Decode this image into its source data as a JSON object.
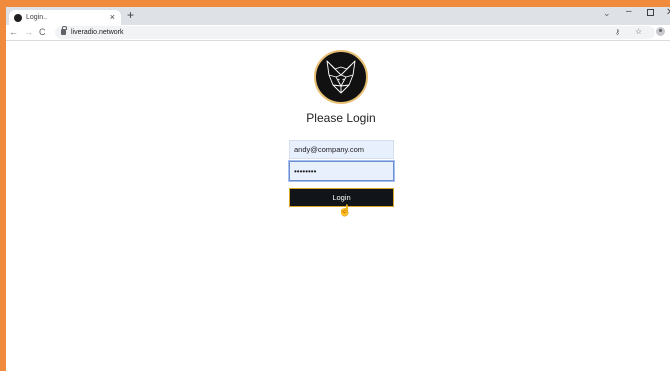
{
  "browser": {
    "tab": {
      "title": "Login..",
      "close_glyph": "×"
    },
    "new_tab_glyph": "+",
    "tab_search_glyph": "⌄",
    "window": {
      "minimize_glyph": "–",
      "close_glyph": "✕"
    },
    "nav": {
      "back_glyph": "←",
      "forward_glyph": "→",
      "reload_glyph": "C"
    },
    "address_bar": {
      "url": "liveradio.network"
    },
    "toolbar_icons": {
      "key_glyph": "⚷",
      "star_glyph": "☆",
      "menu_glyph": "⋮"
    }
  },
  "login": {
    "title": "Please Login",
    "email_value": "andy@company.com",
    "password_value": "••••••••",
    "button_label": "Login"
  },
  "colors": {
    "frame_accent": "#f08a3c",
    "logo_ring": "#e6bf73",
    "button_bg": "#111418",
    "button_border": "#d8a62a",
    "autofill_bg": "#e8f0fe"
  },
  "icons": {
    "logo": "wolf-head-logo",
    "cursor": "hand-pointer-cursor"
  }
}
